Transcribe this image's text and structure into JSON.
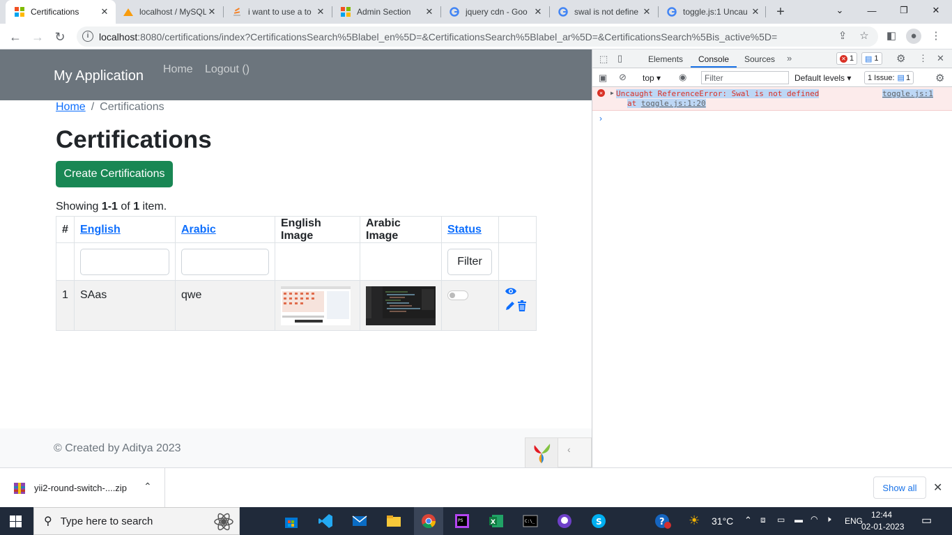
{
  "browser": {
    "tabs": [
      {
        "title": "Certifications",
        "active": true
      },
      {
        "title": "localhost / MySQL"
      },
      {
        "title": "i want to use a to"
      },
      {
        "title": "Admin Section"
      },
      {
        "title": "jquery cdn - Goo"
      },
      {
        "title": "swal is not define"
      },
      {
        "title": "toggle.js:1 Uncau"
      }
    ],
    "url_host": "localhost",
    "url_rest": ":8080/certifications/index?CertificationsSearch%5Blabel_en%5D=&CertificationsSearch%5Blabel_ar%5D=&CertificationsSearch%5Bis_active%5D="
  },
  "app": {
    "brand": "My Application",
    "nav": {
      "home": "Home",
      "logout": "Logout ()"
    },
    "breadcrumb": {
      "home": "Home",
      "current": "Certifications"
    },
    "title": "Certifications",
    "create_button": "Create Certifications",
    "summary": {
      "prefix": "Showing ",
      "range": "1-1",
      "mid": " of ",
      "count": "1",
      "suffix": " item."
    },
    "grid": {
      "headers": {
        "num": "#",
        "english": "English",
        "arabic": "Arabic",
        "english_image": "English Image",
        "arabic_image": "Arabic Image",
        "status": "Status"
      },
      "filter_button": "Filter",
      "rows": [
        {
          "num": "1",
          "english": "SAas",
          "arabic": "qwe"
        }
      ]
    },
    "footer": "© Created by Aditya 2023"
  },
  "devtools": {
    "tabs": {
      "elements": "Elements",
      "console": "Console",
      "sources": "Sources"
    },
    "error_count": "1",
    "message_count": "1",
    "context": "top",
    "filter_placeholder": "Filter",
    "levels": "Default levels",
    "issues": "1 Issue:",
    "issues_count": "1",
    "error": {
      "message": "Uncaught ReferenceError: Swal is not defined",
      "stack_prefix": "at ",
      "stack_link": "toggle.js:1:20",
      "source": "toggle.js:1"
    }
  },
  "downloads": {
    "file": "yii2-round-switch-....zip",
    "show_all": "Show all"
  },
  "taskbar": {
    "search": "Type here to search",
    "weather": "31°C",
    "lang": "ENG",
    "time": "12:44",
    "date": "02-01-2023"
  },
  "colors": {
    "navbar": "#6c757d",
    "primary": "#0d6efd",
    "success": "#198754",
    "devtools_accent": "#1a73e8",
    "error_bg": "#fcebeb"
  }
}
